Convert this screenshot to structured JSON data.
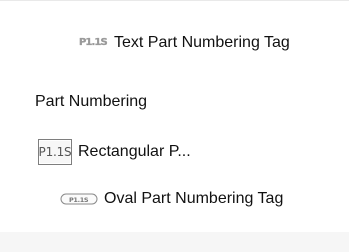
{
  "panel": {
    "heading": "Part Numbering",
    "items": [
      {
        "label": "Text Part Numbering Tag",
        "icon_name": "text-part-numbering-tag-icon",
        "icon_text": "P1.1S"
      },
      {
        "label": "Rectangular P...",
        "icon_name": "rectangular-part-numbering-tag-icon",
        "icon_text": "P1.1S"
      },
      {
        "label": "Oval Part Numbering Tag",
        "icon_name": "oval-part-numbering-tag-icon",
        "icon_text": "P1.1S"
      }
    ]
  },
  "colors": {
    "background": "#ffffff",
    "text": "#111111",
    "icon_gray": "#777777",
    "icon_border": "#7e7e7e"
  }
}
